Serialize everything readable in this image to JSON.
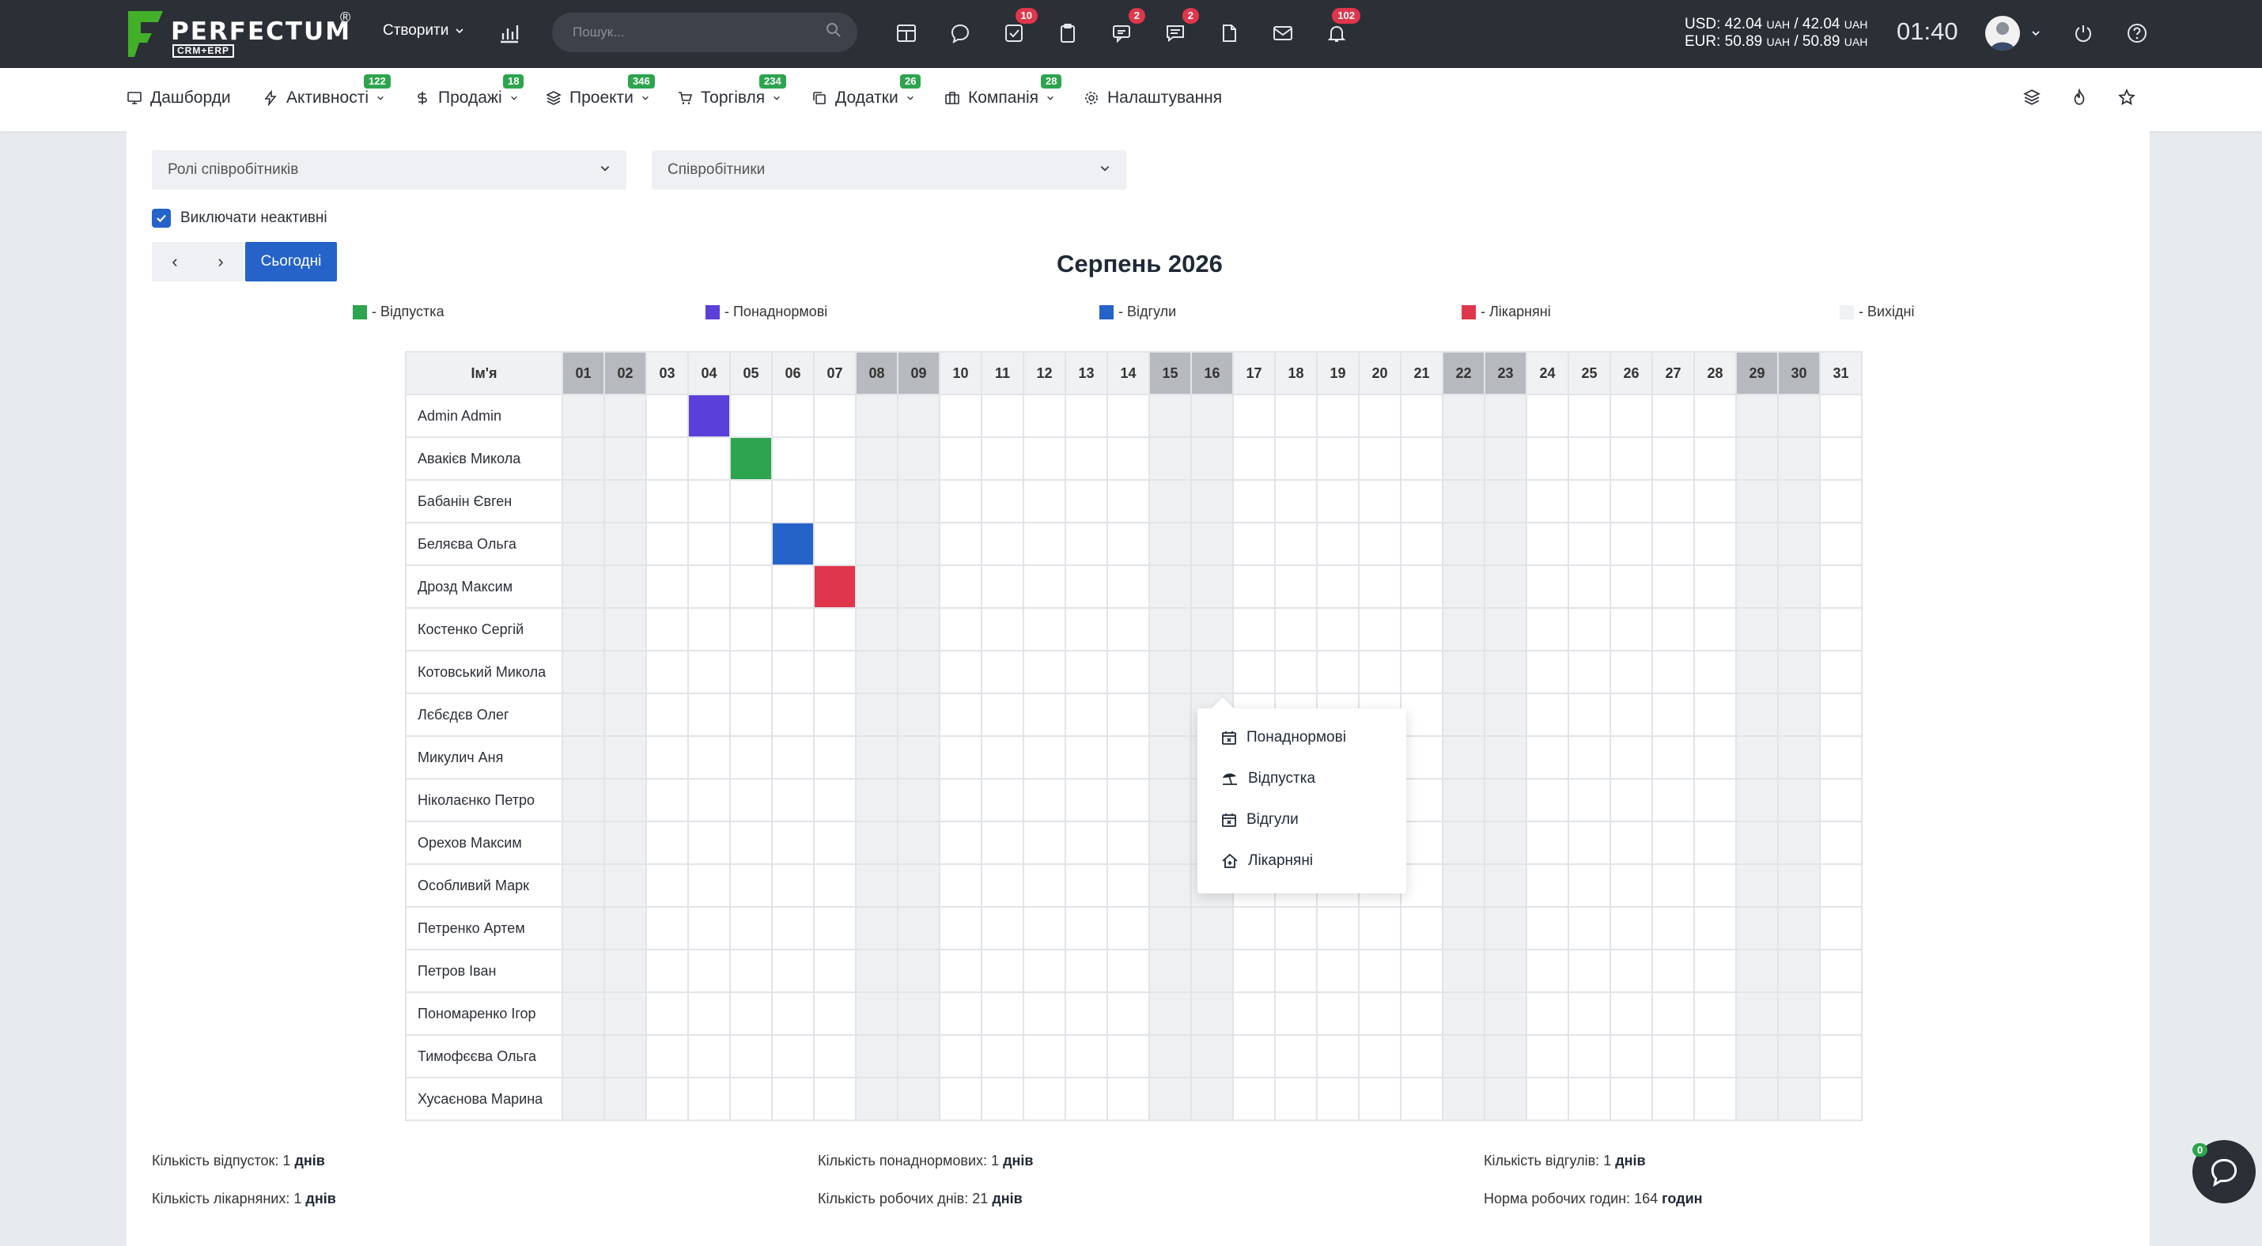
{
  "topbar": {
    "logo": "PERFECTUM",
    "logo_sub": "CRM+ERP",
    "logo_reg": "®",
    "create_label": "Створити",
    "search_placeholder": "Пошук...",
    "badges": {
      "tasks": "10",
      "comments": "2",
      "messages": "2",
      "notifications": "102"
    },
    "usd_label": "USD: 42.04",
    "usd_unit1": "UAH",
    "usd_sep": "/ 42.04",
    "usd_unit2": "UAH",
    "eur_label": "EUR: 50.89",
    "eur_unit1": "UAH",
    "eur_sep": "/ 50.89",
    "eur_unit2": "UAH",
    "time": "01:40"
  },
  "navbar": {
    "items": [
      {
        "label": "Дашборди",
        "icon": "monitor-icon",
        "badge": ""
      },
      {
        "label": "Активності",
        "icon": "lightning-icon",
        "badge": "122"
      },
      {
        "label": "Продажі",
        "icon": "dollar-icon",
        "badge": "18"
      },
      {
        "label": "Проекти",
        "icon": "layers-icon",
        "badge": "346"
      },
      {
        "label": "Торгівля",
        "icon": "cart-icon",
        "badge": "234"
      },
      {
        "label": "Додатки",
        "icon": "copy-icon",
        "badge": "26"
      },
      {
        "label": "Компанія",
        "icon": "briefcase-icon",
        "badge": "28"
      },
      {
        "label": "Налаштування",
        "icon": "gear-icon",
        "badge": ""
      }
    ]
  },
  "filters": {
    "roles_placeholder": "Ролі співробітників",
    "employees_placeholder": "Співробітники",
    "exclude_inactive": "Виключати неактивні"
  },
  "controls": {
    "prev": "‹",
    "next": "›",
    "today": "Сьогодні"
  },
  "month_title": "Серпень 2026",
  "legend": [
    {
      "label": "- Відпустка",
      "color": "#2da44e"
    },
    {
      "label": "- Понаднормові",
      "color": "#5b3fd9"
    },
    {
      "label": "- Відгули",
      "color": "#2563c9"
    },
    {
      "label": "- Лікарняні",
      "color": "#e0364c"
    },
    {
      "label": "- Вихідні",
      "color": "#f0f1f3"
    }
  ],
  "table": {
    "name_header": "Ім'я",
    "days": [
      "01",
      "02",
      "03",
      "04",
      "05",
      "06",
      "07",
      "08",
      "09",
      "10",
      "11",
      "12",
      "13",
      "14",
      "15",
      "16",
      "17",
      "18",
      "19",
      "20",
      "21",
      "22",
      "23",
      "24",
      "25",
      "26",
      "27",
      "28",
      "29",
      "30",
      "31"
    ],
    "weekends": [
      "01",
      "02",
      "08",
      "09",
      "15",
      "16",
      "22",
      "23",
      "29",
      "30"
    ],
    "employees": [
      {
        "name": "Admin Admin",
        "marks": {
          "04": "#5b3fd9"
        }
      },
      {
        "name": "Авакієв Микола",
        "marks": {
          "05": "#2da44e"
        }
      },
      {
        "name": "Бабанін Євген",
        "marks": {}
      },
      {
        "name": "Беляєва Ольга",
        "marks": {
          "06": "#2563c9"
        }
      },
      {
        "name": "Дрозд Максим",
        "marks": {
          "07": "#e0364c"
        }
      },
      {
        "name": "Костенко Сергій",
        "marks": {}
      },
      {
        "name": "Котовський Микола",
        "marks": {}
      },
      {
        "name": "Лєбєдєв Олег",
        "marks": {}
      },
      {
        "name": "Микулич Аня",
        "marks": {}
      },
      {
        "name": "Ніколаєнко Петро",
        "marks": {}
      },
      {
        "name": "Орехов Максим",
        "marks": {}
      },
      {
        "name": "Особливий Марк",
        "marks": {}
      },
      {
        "name": "Петренко Артем",
        "marks": {}
      },
      {
        "name": "Петров Іван",
        "marks": {}
      },
      {
        "name": "Пономаренко Ігор",
        "marks": {}
      },
      {
        "name": "Тимофєєва Ольга",
        "marks": {}
      },
      {
        "name": "Хусаєнова Марина",
        "marks": {}
      }
    ]
  },
  "popup": {
    "items": [
      "Понаднормові",
      "Відпустка",
      "Відгули",
      "Лікарняні"
    ]
  },
  "stats": {
    "vacations_label": "Кількість відпусток:",
    "vacations_value": "1",
    "vacations_unit": "днів",
    "overtime_label": "Кількість понаднормових:",
    "overtime_value": "1",
    "overtime_unit": "днів",
    "timeoff_label": "Кількість відгулів:",
    "timeoff_value": "1",
    "timeoff_unit": "днів",
    "sick_label": "Кількість лікарняних:",
    "sick_value": "1",
    "sick_unit": "днів",
    "workdays_label": "Кількість робочих днів:",
    "workdays_value": "21",
    "workdays_unit": "днів",
    "hours_label": "Норма робочих годин:",
    "hours_value": "164",
    "hours_unit": "годин"
  },
  "chat_badge": "0"
}
